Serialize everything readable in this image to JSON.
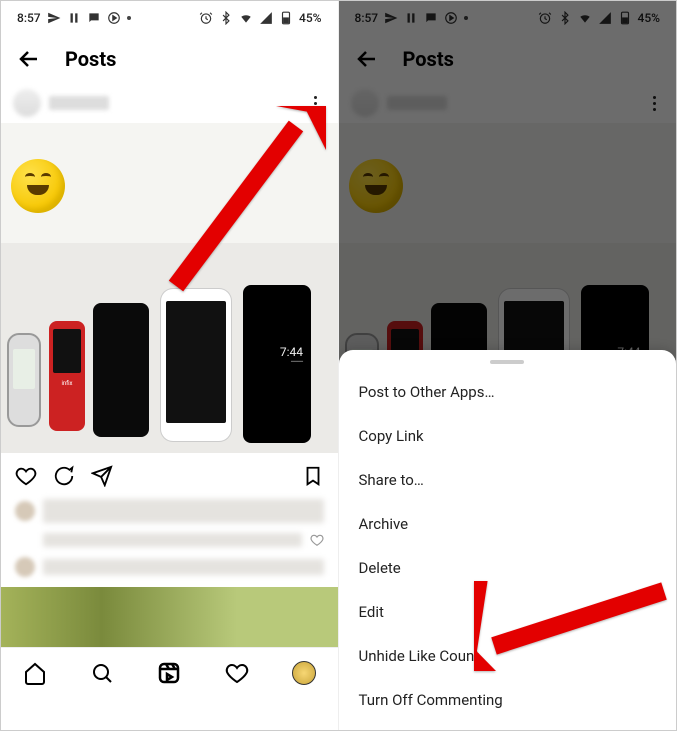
{
  "status": {
    "time": "8:57",
    "battery_text": "45%",
    "icons_left": [
      "send",
      "pause",
      "message",
      "circle-play"
    ],
    "icons_right": [
      "alarm",
      "bluetooth",
      "wifi",
      "signal",
      "battery"
    ]
  },
  "header": {
    "title": "Posts"
  },
  "photo": {
    "lock_time": "7:44"
  },
  "nav": {
    "items": [
      "home",
      "search",
      "reels",
      "activity",
      "profile"
    ]
  },
  "sheet": {
    "items": [
      "Post to Other Apps…",
      "Copy Link",
      "Share to…",
      "Archive",
      "Delete",
      "Edit",
      "Unhide Like Count",
      "Turn Off Commenting"
    ]
  }
}
